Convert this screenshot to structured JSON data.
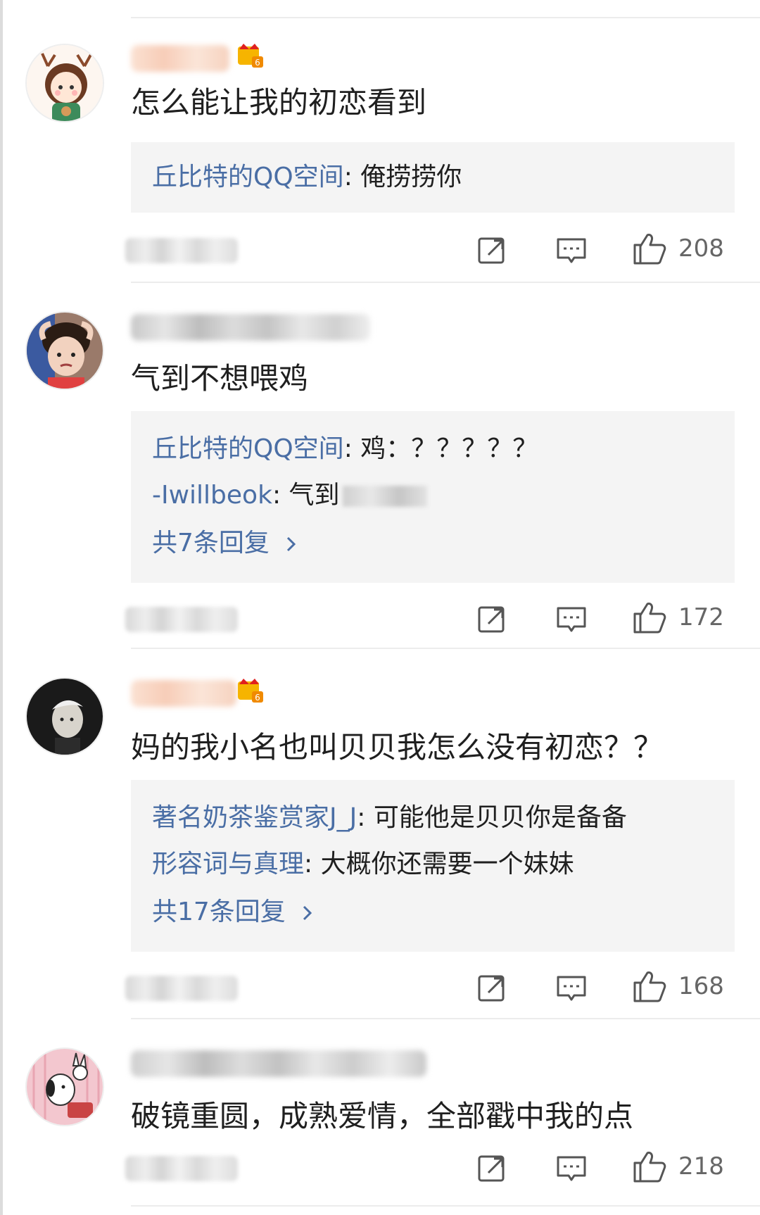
{
  "comments": [
    {
      "text": "怎么能让我的初恋看到",
      "replies": [
        {
          "author": "丘比特的QQ空间",
          "text": ": 俺捞捞你"
        }
      ],
      "more": "",
      "likes": "208"
    },
    {
      "text": "气到不想喂鸡",
      "replies": [
        {
          "author": "丘比特的QQ空间",
          "text": ": 鸡：？？？？？"
        },
        {
          "author": "-Iwillbeok",
          "text": ": 气到"
        }
      ],
      "more": "共7条回复",
      "likes": "172"
    },
    {
      "text": "妈的我小名也叫贝贝我怎么没有初恋？？",
      "replies": [
        {
          "author": "著名奶茶鉴赏家J_J",
          "text": ": 可能他是贝贝你是备备"
        },
        {
          "author": "形容词与真理",
          "text": ": 大概你还需要一个妹妹"
        }
      ],
      "more": "共17条回复",
      "likes": "168"
    },
    {
      "text": "破镜重圆，成熟爱情，全部戳中我的点",
      "replies": [],
      "more": "",
      "likes": "218"
    }
  ],
  "icons": {
    "share": "share-icon",
    "comment": "comment-icon",
    "like": "thumbs-up-icon",
    "more_arrow": "chevron-right-icon"
  },
  "colors": {
    "link": "#4a6ea5",
    "reply_bg": "#f4f4f4",
    "text": "#1f1f1f",
    "meta": "#666666"
  }
}
